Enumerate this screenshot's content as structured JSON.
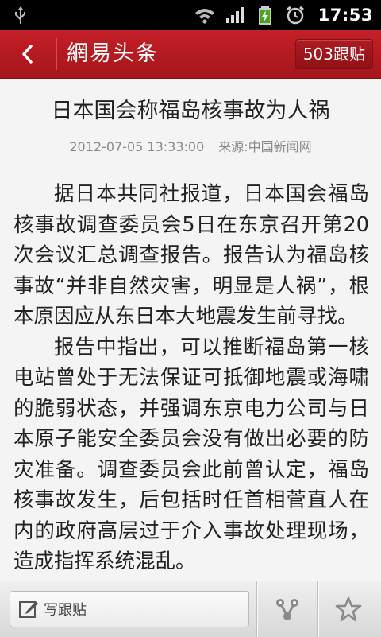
{
  "status_bar": {
    "time": "17:53",
    "icons": [
      "usb-icon",
      "wifi-icon",
      "signal-icon",
      "battery-charging-icon",
      "alarm-icon"
    ]
  },
  "header": {
    "title": "網易头条",
    "follow_button": "503跟贴",
    "back_icon": "back-arrow-icon"
  },
  "article": {
    "title": "日本国会称福岛核事故为人祸",
    "date": "2012-07-05 13:33:00",
    "source": "来源:中国新闻网",
    "paragraphs": [
      "据日本共同社报道，日本国会福岛核事故调查委员会5日在东京召开第20次会议汇总调查报告。报告认为福岛核事故“并非自然灾害，明显是人祸”，根本原因应从东日本大地震发生前寻找。",
      "报告中指出，可以推断福岛第一核电站曾处于无法保证可抵御地震或海啸的脆弱状态，并强调东京电力公司与日本原子能安全委员会没有做出必要的防灾准备。调查委员会此前曾认定，福岛核事故发生，后包括时任首相菅直人在内的政府高层过于介入事故处理现场，造成指挥系统混乱。"
    ]
  },
  "bottom_bar": {
    "comment_placeholder": "写跟贴",
    "comment_icon": "edit-icon",
    "share_icon": "share-icon",
    "favorite_icon": "star-icon"
  }
}
